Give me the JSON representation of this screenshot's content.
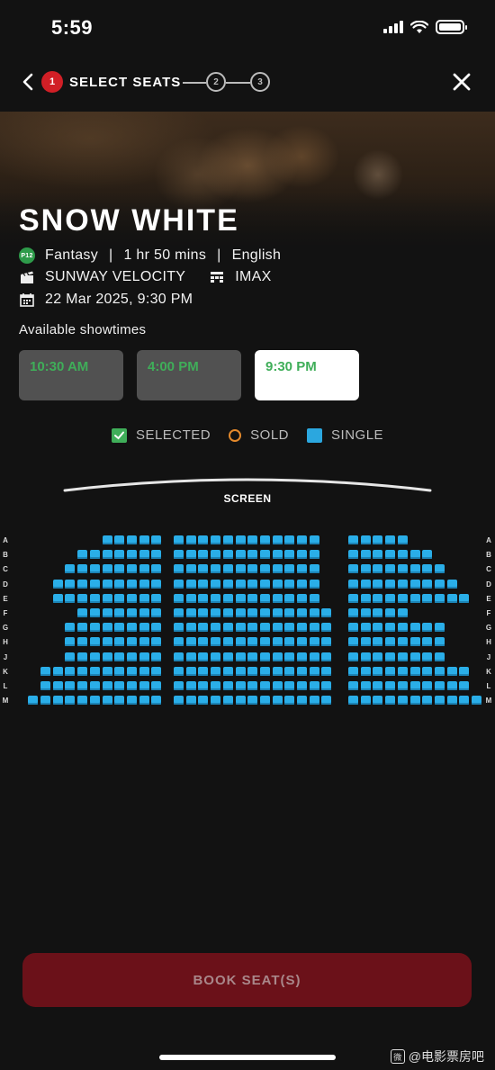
{
  "status_bar": {
    "time": "5:59"
  },
  "nav": {
    "step_active": "1",
    "step_title": "SELECT SEATS",
    "steps": [
      "2",
      "3"
    ]
  },
  "movie": {
    "title": "SNOW WHITE",
    "rating": "P12",
    "genre": "Fantasy",
    "duration": "1 hr 50 mins",
    "language": "English",
    "cinema": "SUNWAY VELOCITY",
    "format": "IMAX",
    "datetime": "22 Mar 2025, 9:30 PM"
  },
  "showtimes": {
    "label": "Available showtimes",
    "items": [
      "10:30 AM",
      "4:00 PM",
      "9:30 PM"
    ],
    "selected": "9:30 PM"
  },
  "legend": {
    "selected": "SELECTED",
    "sold": "SOLD",
    "single": "SINGLE"
  },
  "colors": {
    "seat_available": "#2aaee8",
    "selected": "#3fae59",
    "sold": "#e58a2c",
    "book_button": "#6b1119",
    "accent_red": "#d11f26"
  },
  "screen_label": "SCREEN",
  "seat_map": {
    "rows": [
      "A",
      "B",
      "C",
      "D",
      "E",
      "F",
      "G",
      "H",
      "J",
      "K",
      "L",
      "M"
    ],
    "seats_per_row": {
      "left": [
        5,
        7,
        8,
        9,
        9,
        7,
        8,
        8,
        8,
        10,
        10,
        11
      ],
      "center": [
        12,
        12,
        12,
        12,
        12,
        13,
        13,
        13,
        13,
        13,
        13,
        13
      ],
      "right": [
        5,
        7,
        8,
        9,
        10,
        5,
        8,
        8,
        8,
        10,
        10,
        11
      ]
    }
  },
  "book_button": "BOOK SEAT(S)",
  "watermark": "@电影票房吧"
}
